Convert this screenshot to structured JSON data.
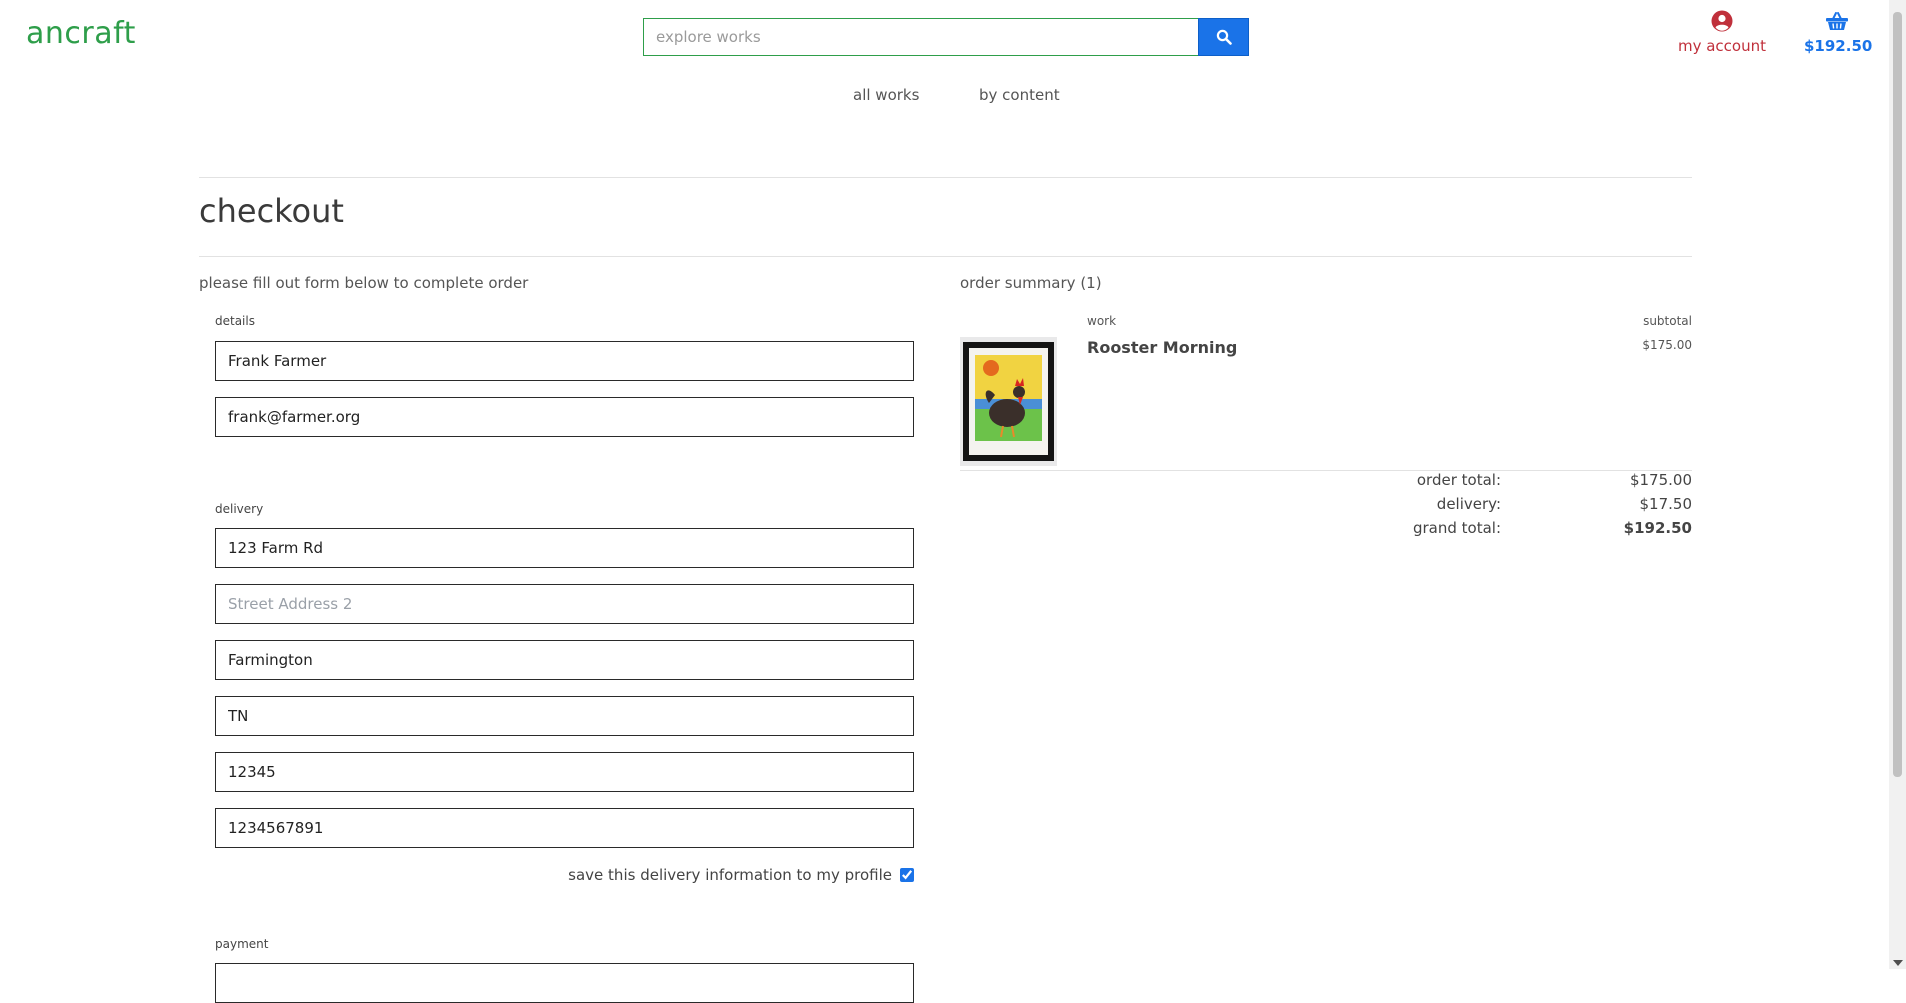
{
  "brand": {
    "logo": "ancraft",
    "accent": "#2e9e4a"
  },
  "search": {
    "placeholder": "explore works",
    "icon": "search-icon"
  },
  "header": {
    "account_label": "my account",
    "account_icon": "user-circle-icon",
    "cart_total": "$192.50",
    "cart_icon": "basket-icon"
  },
  "nav": {
    "all_works": "all works",
    "by_content": "by content"
  },
  "page": {
    "title": "checkout",
    "intro": "please fill out form below to complete order"
  },
  "details": {
    "label": "details",
    "name_value": "Frank Farmer",
    "email_value": "frank@farmer.org"
  },
  "delivery": {
    "label": "delivery",
    "street1_value": "123 Farm Rd",
    "street2_placeholder": "Street Address 2",
    "city_value": "Farmington",
    "state_value": "TN",
    "zip_value": "12345",
    "phone_value": "1234567891",
    "save_label": "save this delivery information to my profile",
    "save_checked": true
  },
  "payment": {
    "label": "payment"
  },
  "summary": {
    "title": "order summary (1)",
    "work_header": "work",
    "subtotal_header": "subtotal",
    "items": [
      {
        "title": "Rooster Morning",
        "subtotal": "$175.00"
      }
    ],
    "order_total_label": "order total:",
    "order_total_value": "$175.00",
    "delivery_label": "delivery:",
    "delivery_value": "$17.50",
    "grand_total_label": "grand total:",
    "grand_total_value": "$192.50"
  },
  "colors": {
    "link_blue": "#1a73e8",
    "account_red": "#c0303b"
  }
}
